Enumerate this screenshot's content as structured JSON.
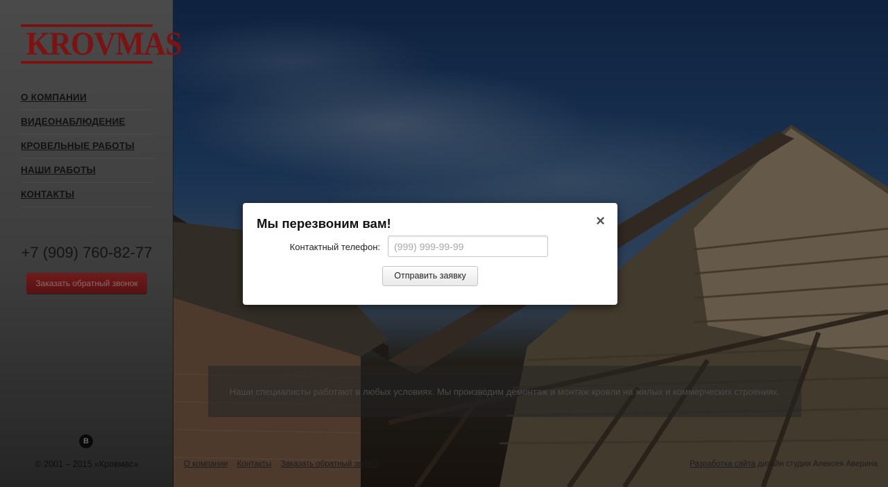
{
  "brand": {
    "logo_text": "KROVMAS",
    "color": "#7a1414"
  },
  "nav": {
    "items": [
      {
        "label": "О КОМПАНИИ"
      },
      {
        "label": "ВИДЕОНАБЛЮДЕНИЕ"
      },
      {
        "label": "КРОВЕЛЬНЫЕ РАБОТЫ"
      },
      {
        "label": "НАШИ РАБОТЫ"
      },
      {
        "label": "КОНТАКТЫ"
      }
    ]
  },
  "contact": {
    "phone": "+7 (909) 760-82-77",
    "callback_label": "Заказать обратный звонок"
  },
  "social": {
    "vk_label": "В",
    "icon": "vk-icon"
  },
  "footer": {
    "copyright": "© 2001 – 2015 «Кровмас»",
    "links": [
      "О компании",
      "Контакты",
      "Заказать обратный звонок"
    ],
    "credit_link": "Разработка сайта",
    "credit_text": "дизайн студия Алексея Аверина"
  },
  "hero": {
    "text": "Наши специалисты работают в любых условиях. Мы производим демонтаж и монтаж кровли на жилых и коммерческих строениях."
  },
  "modal": {
    "title": "Мы перезвоним вам!",
    "close_glyph": "×",
    "phone_label": "Контактный телефон:",
    "phone_placeholder": "(999) 999-99-99",
    "phone_value": "",
    "submit_label": "Отправить заявку"
  }
}
